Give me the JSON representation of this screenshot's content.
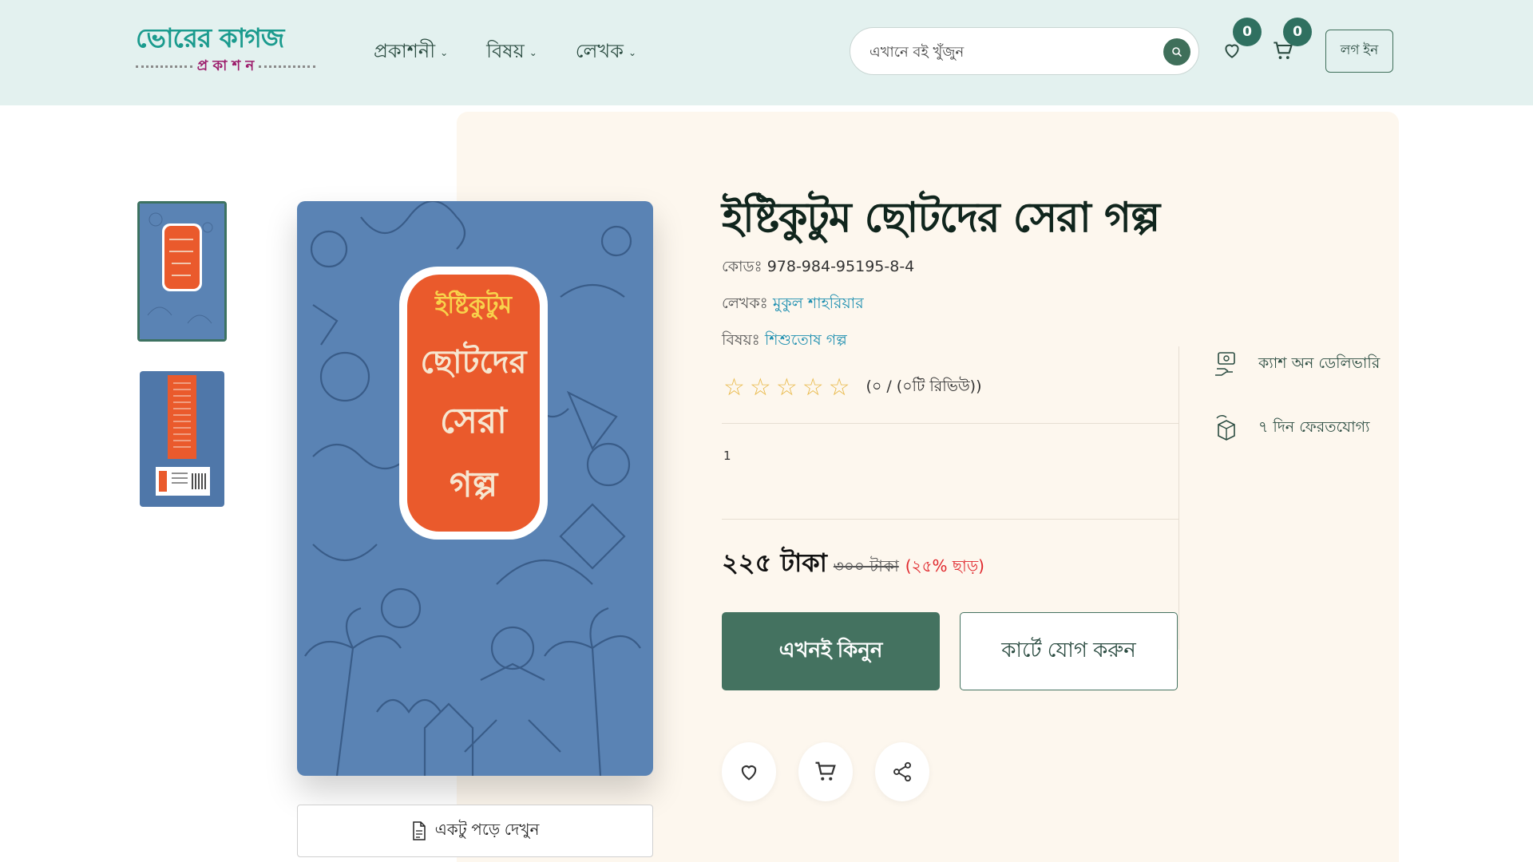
{
  "header": {
    "logo": {
      "main": "ভোরের কাগজ",
      "sub": "প্র কা শ ন"
    },
    "nav": [
      {
        "label": "প্রকাশনী"
      },
      {
        "label": "বিষয়"
      },
      {
        "label": "লেখক"
      }
    ],
    "search": {
      "placeholder": "এখানে বই খুঁজুন"
    },
    "wishlist_count": "0",
    "cart_count": "0",
    "login_label": "লগ ইন"
  },
  "product": {
    "title": "ইষ্টিকুটুম ছোটদের সেরা গল্প",
    "code_label": "কোডঃ",
    "code": "978-984-95195-8-4",
    "author_label": "লেখকঃ",
    "author": "মুকুল শাহরিয়ার",
    "subject_label": "বিষয়ঃ",
    "subject": "শিশুতোষ গল্প",
    "rating_value": 0,
    "rating_text": "(০ / (০টি রিভিউ))",
    "description": "1",
    "price_now": "২২৫ টাকা",
    "price_old": "৩০০ টাকা",
    "discount": "(২৫% ছাড়)",
    "buy_now_label": "এখনই কিনুন",
    "add_to_cart_label": "কার্টে যোগ করুন",
    "preview_label": "একটু পড়ে দেখুন",
    "cover_title_lines": [
      "ইষ্টিকুটুম",
      "ছোটদের",
      "সেরা",
      "গল্প"
    ]
  },
  "features": [
    {
      "label": "ক্যাশ অন ডেলিভারি",
      "icon": "cash-delivery-icon"
    },
    {
      "label": "৭ দিন ফেরতযোগ্য",
      "icon": "return-box-icon"
    }
  ],
  "colors": {
    "header_bg": "#e3f1ef",
    "accent": "#447260",
    "panel_bg": "#fdf7ee",
    "link": "#1e8fb0",
    "discount": "#e0262b",
    "cover_blue": "#5a83b4",
    "cover_orange": "#ea5a2c"
  }
}
